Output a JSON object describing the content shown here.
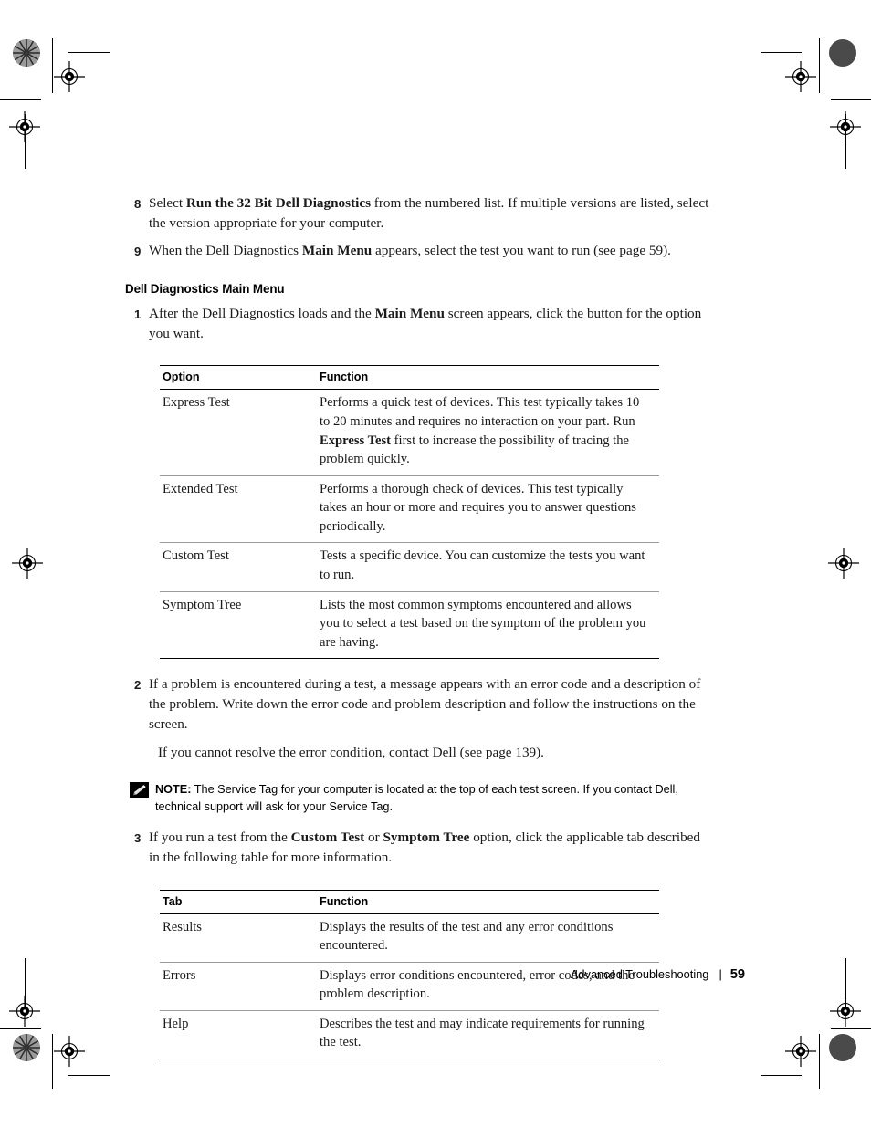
{
  "document": {
    "steps_top": [
      {
        "number": "8",
        "text_before": "Select ",
        "bold1": "Run the 32 Bit Dell Diagnostics",
        "text_after": " from the numbered list. If multiple versions are listed, select the version appropriate for your computer."
      },
      {
        "number": "9",
        "text_before": "When the Dell Diagnostics ",
        "bold1": "Main Menu",
        "text_after": " appears, select the test you want to run (see page 59)."
      }
    ],
    "section_heading": "Dell Diagnostics Main Menu",
    "step_1": {
      "number": "1",
      "text_before": "After the Dell Diagnostics loads and the ",
      "bold1": "Main Menu",
      "text_after": " screen appears, click the button for the option you want."
    },
    "options_table": {
      "headers": [
        "Option",
        "Function"
      ],
      "rows": [
        {
          "option": "Express Test",
          "function_before": "Performs a quick test of devices. This test typically takes 10 to 20 minutes and requires no interaction on your part. Run ",
          "function_bold": "Express Test",
          "function_after": " first to increase the possibility of tracing the problem quickly."
        },
        {
          "option": "Extended Test",
          "function_before": "Performs a thorough check of devices. This test typically takes an hour or more and requires you to answer questions periodically.",
          "function_bold": "",
          "function_after": ""
        },
        {
          "option": "Custom Test",
          "function_before": "Tests a specific device. You can customize the tests you want to run.",
          "function_bold": "",
          "function_after": ""
        },
        {
          "option": "Symptom Tree",
          "function_before": "Lists the most common symptoms encountered and allows you to select a test based on the symptom of the problem you are having.",
          "function_bold": "",
          "function_after": ""
        }
      ]
    },
    "step_2": {
      "number": "2",
      "text": "If a problem is encountered during a test, a message appears with an error code and a description of the problem. Write down the error code and problem description and follow the instructions on the screen.",
      "sub_paragraph": "If you cannot resolve the error condition, contact Dell (see page 139)."
    },
    "note": {
      "icon": "pencil-note-icon",
      "label": "NOTE:",
      "text": " The Service Tag for your computer is located at the top of each test screen. If you contact Dell, technical support will ask for your Service Tag."
    },
    "step_3": {
      "number": "3",
      "text_before": "If you run a test from the ",
      "bold1": "Custom Test",
      "text_mid": " or ",
      "bold2": "Symptom Tree",
      "text_after": " option, click the applicable tab described in the following table for more information."
    },
    "tabs_table": {
      "headers": [
        "Tab",
        "Function"
      ],
      "rows": [
        {
          "tab": "Results",
          "function": "Displays the results of the test and any error conditions encountered."
        },
        {
          "tab": "Errors",
          "function": "Displays error conditions encountered, error codes, and the problem description."
        },
        {
          "tab": "Help",
          "function": "Describes the test and may indicate requirements for running the test."
        }
      ]
    },
    "footer": {
      "chapter": "Advanced Troubleshooting",
      "separator": "|",
      "page_number": "59"
    }
  },
  "print_marks": {
    "registration_icon": "registration-target-icon",
    "halftone_icon": "halftone-star-target-icon",
    "solid_dot_icon": "solid-density-dot-icon"
  }
}
